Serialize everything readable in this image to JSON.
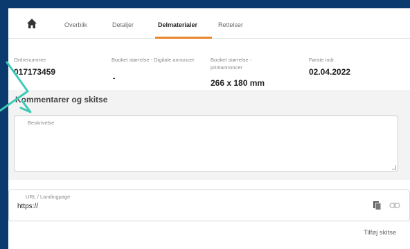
{
  "tabs": {
    "home_icon": "home-icon",
    "items": [
      {
        "label": "Overblik"
      },
      {
        "label": "Detaljer"
      },
      {
        "label": "Delmaterialer"
      },
      {
        "label": "Rettelser"
      }
    ],
    "active_index": 2,
    "accent_color": "#e8862a"
  },
  "info": [
    {
      "label": "Ordrenummer",
      "value": "017173459"
    },
    {
      "label": "Booket størrelse - Digitale annoncer",
      "value": "-"
    },
    {
      "label": "Booket størrelse - printannoncer",
      "value": "266 x 180 mm"
    },
    {
      "label": "Første indr.",
      "value": "02.04.2022"
    }
  ],
  "comments": {
    "title": "Kommentarer og skitse",
    "description_label": "Beskrivelse",
    "description_value": ""
  },
  "url": {
    "label": "URL / Landingpage",
    "value": "https://",
    "copy_icon": "copy-icon",
    "link_icon": "link-icon"
  },
  "actions": {
    "add_sketch_label": "Tilføj skitse"
  },
  "annotation_arrow_color": "#3ec9b8"
}
